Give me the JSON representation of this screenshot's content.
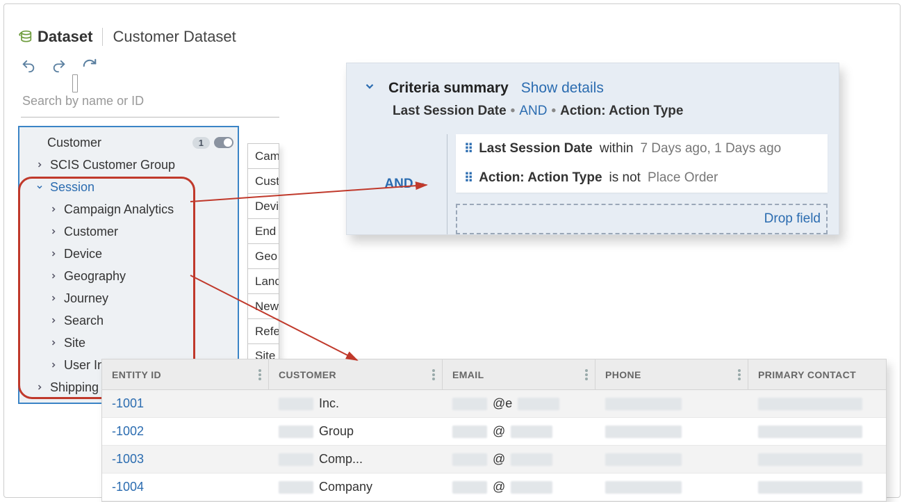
{
  "header": {
    "section_label": "Dataset",
    "title": "Customer Dataset"
  },
  "search": {
    "placeholder": "Search by name or ID"
  },
  "tree": {
    "top_label": "Customer",
    "top_badge": "1",
    "scis_label": "SCIS Customer Group",
    "session_label": "Session",
    "session_children": [
      "Campaign Analytics",
      "Customer",
      "Device",
      "Geography",
      "Journey",
      "Search",
      "Site",
      "User Int"
    ],
    "shipping_label": "Shipping"
  },
  "columns_partial": [
    "Cam",
    "Cust",
    "Devi",
    "End",
    "Geo",
    "Lanc",
    "New",
    "Refe",
    "Site"
  ],
  "criteria": {
    "title": "Criteria summary",
    "show_details": "Show details",
    "sub_left": "Last Session Date",
    "sub_and": "AND",
    "sub_right": "Action: Action Type",
    "join_label": "AND",
    "rules": [
      {
        "field": "Last Session Date",
        "op": "within",
        "value": "7 Days ago, 1 Days ago"
      },
      {
        "field": "Action: Action Type",
        "op": "is not",
        "value": "Place Order"
      }
    ],
    "dropzone": "Drop field"
  },
  "table": {
    "headers": [
      "ENTITY ID",
      "CUSTOMER",
      "EMAIL",
      "PHONE",
      "PRIMARY CONTACT"
    ],
    "rows": [
      {
        "id": "-1001",
        "cust_suffix": "Inc.",
        "email_mid": "@e"
      },
      {
        "id": "-1002",
        "cust_suffix": "Group",
        "email_mid": "@"
      },
      {
        "id": "-1003",
        "cust_suffix": "Comp...",
        "email_mid": "@"
      },
      {
        "id": "-1004",
        "cust_suffix": "Company",
        "email_mid": "@"
      }
    ]
  }
}
